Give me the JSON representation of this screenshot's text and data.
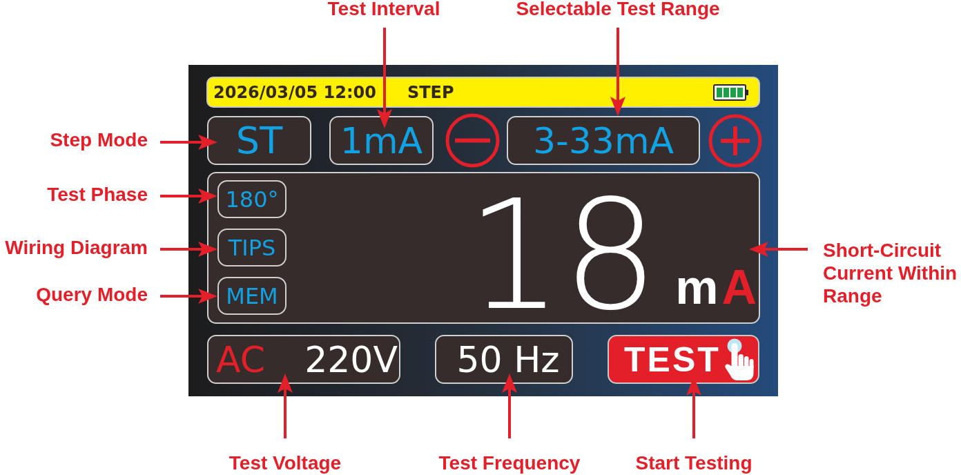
{
  "callouts": [
    "Test Interval",
    "Selectable Test Range",
    "Step Mode",
    "Test Phase",
    "Wiring Diagram",
    "Query Mode",
    "Short-Circuit Current Within Range",
    "Test Voltage",
    "Test Frequency",
    "Start Testing"
  ],
  "screen": {
    "status_bar": {
      "datetime": "2026/03/05 12:00",
      "mode": "STEP"
    },
    "settings": {
      "step_mode": "ST",
      "interval": "1mA",
      "range": "3-33mA"
    },
    "side_buttons": [
      "180°",
      "TIPS",
      "MEM"
    ],
    "reading": {
      "value": "18",
      "unit_prefix": "m",
      "unit": "A"
    },
    "voltage": {
      "type": "AC",
      "value": "220V"
    },
    "frequency": "50 Hz",
    "test_button": "TEST"
  }
}
